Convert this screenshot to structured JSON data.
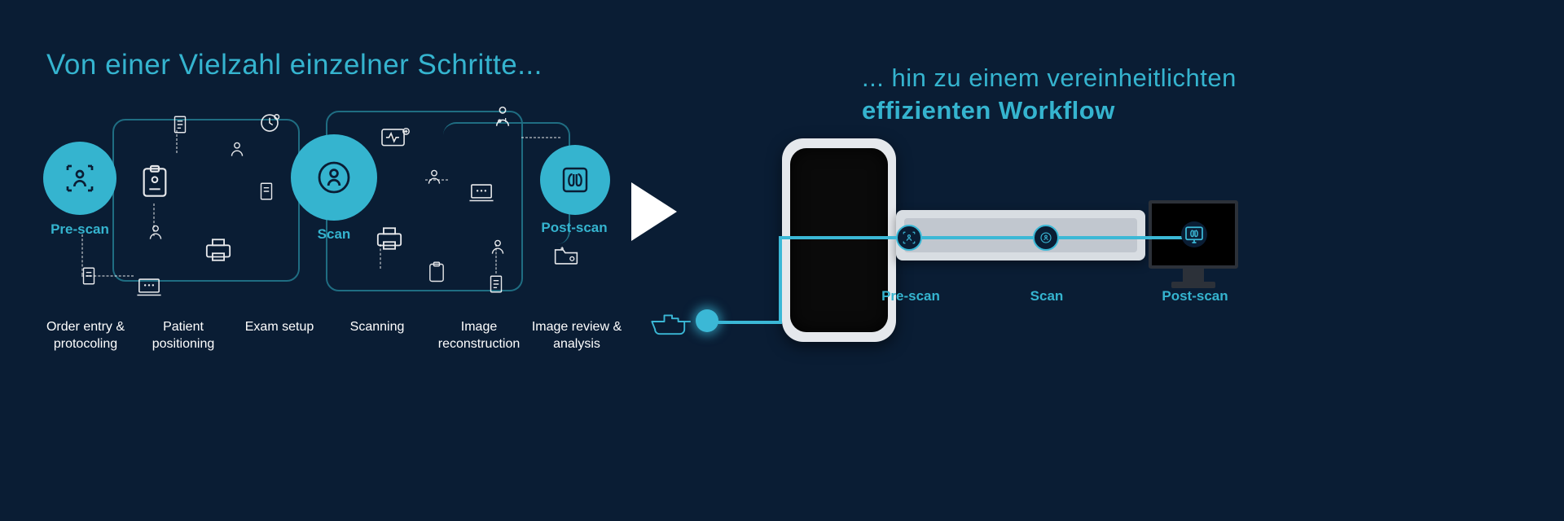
{
  "headings": {
    "left": "Von einer Vielzahl einzelner  Schritte...",
    "right_line1": "... hin zu einem vereinheitlichten",
    "right_line2": "effizienten Workflow"
  },
  "phases": {
    "prescan": "Pre-scan",
    "scan": "Scan",
    "postscan": "Post-scan"
  },
  "steps": {
    "s1": "Order entry & protocoling",
    "s2": "Patient positioning",
    "s3": "Exam setup",
    "s4": "Scanning",
    "s5": "Image reconstruction",
    "s6": "Image review & analysis"
  },
  "right_phases": {
    "r1": "Pre-scan",
    "r2": "Scan",
    "r3": "Post-scan"
  },
  "icons": {
    "prescan_circle": "person-scan-icon",
    "scan_circle": "person-target-icon",
    "postscan_circle": "lungs-scan-icon",
    "play": "play-icon",
    "hand": "pointing-hand-icon",
    "doc": "document-icon",
    "clipboard": "clipboard-icon",
    "person": "person-icon",
    "printer": "printer-icon",
    "clock": "clock-icon",
    "laptop": "laptop-icon",
    "medical_screen": "medical-display-icon",
    "folder_user": "folder-user-icon",
    "doctor": "doctor-icon",
    "monitor_lungs": "lungs-monitor-icon"
  },
  "colors": {
    "accent": "#35b4cf",
    "bg": "#0a1d34",
    "white": "#ffffff"
  }
}
